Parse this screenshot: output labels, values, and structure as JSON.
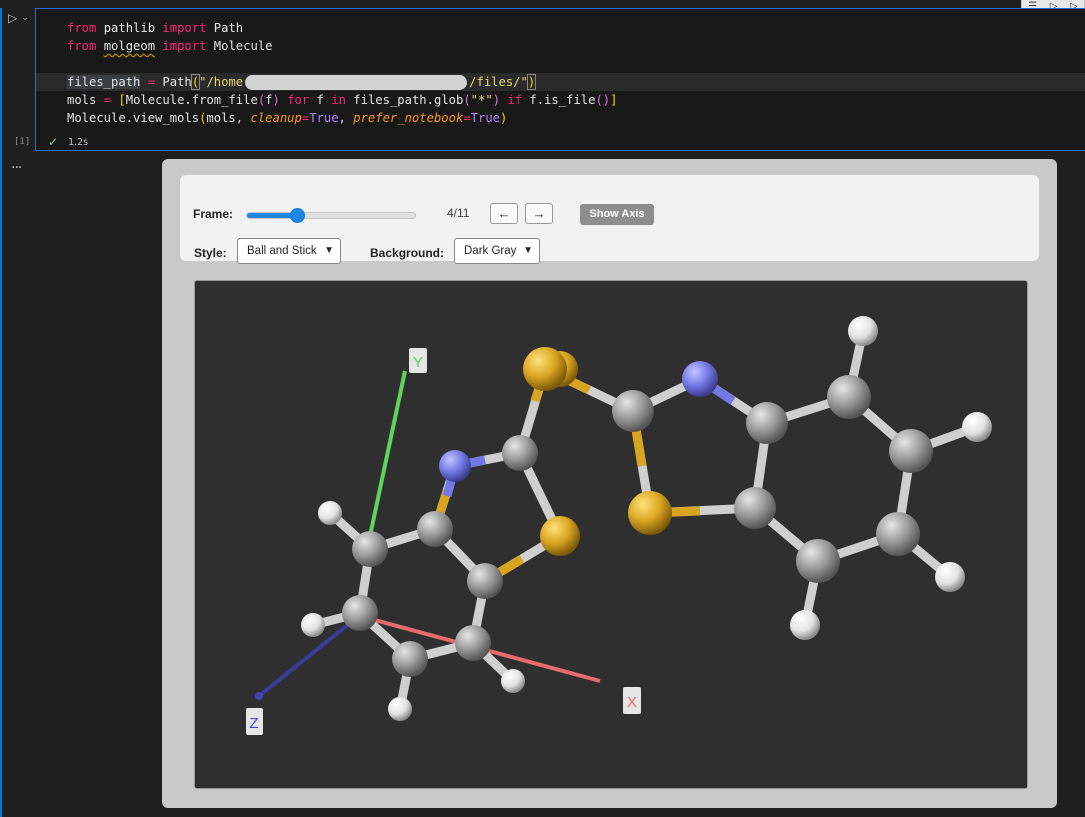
{
  "cell": {
    "execution_count": "[1]",
    "status_time": "1.2s",
    "output_more": "..."
  },
  "code": {
    "line1": {
      "kw1": "from",
      "mod": "pathlib",
      "kw2": "import",
      "name": "Path"
    },
    "line2": {
      "kw1": "from",
      "mod": "molgeom",
      "kw2": "import",
      "name": "Molecule"
    },
    "line4": {
      "var": "files_path",
      "eq": "=",
      "func": "Path",
      "str_start": "\"/home",
      "str_end": "/files/\""
    },
    "line5": {
      "var": "mols",
      "eq": "=",
      "cls": "Molecule.from_file",
      "arg": "f",
      "for": "for",
      "f2": "f",
      "in": "in",
      "expr": "files_path.glob",
      "pattern": "\"*\"",
      "if": "if",
      "cond": "f.is_file"
    },
    "line6": {
      "call": "Molecule.view_mols",
      "arg1": "mols",
      "kw1": "cleanup",
      "val1": "True",
      "kw2": "prefer_notebook",
      "val2": "True"
    }
  },
  "widget": {
    "frame_label": "Frame:",
    "frame_current": 4,
    "frame_total": 11,
    "frame_text": "4/11",
    "prev_label": "←",
    "next_label": "→",
    "show_axis_label": "Show Axis",
    "style_label": "Style:",
    "style_value": "Ball and Stick",
    "background_label": "Background:",
    "background_value": "Dark Gray"
  },
  "viewer": {
    "axis_x": "X",
    "axis_y": "Y",
    "axis_z": "Z",
    "colors": {
      "background": "#2f2f2f",
      "carbon": "#9a9a9a",
      "nitrogen": "#7378e6",
      "sulfur": "#d9a521",
      "hydrogen": "#e8e8e8",
      "axis_x": "#e76b6b",
      "axis_y": "#5fd35f",
      "axis_z": "#3a3a9a"
    }
  }
}
